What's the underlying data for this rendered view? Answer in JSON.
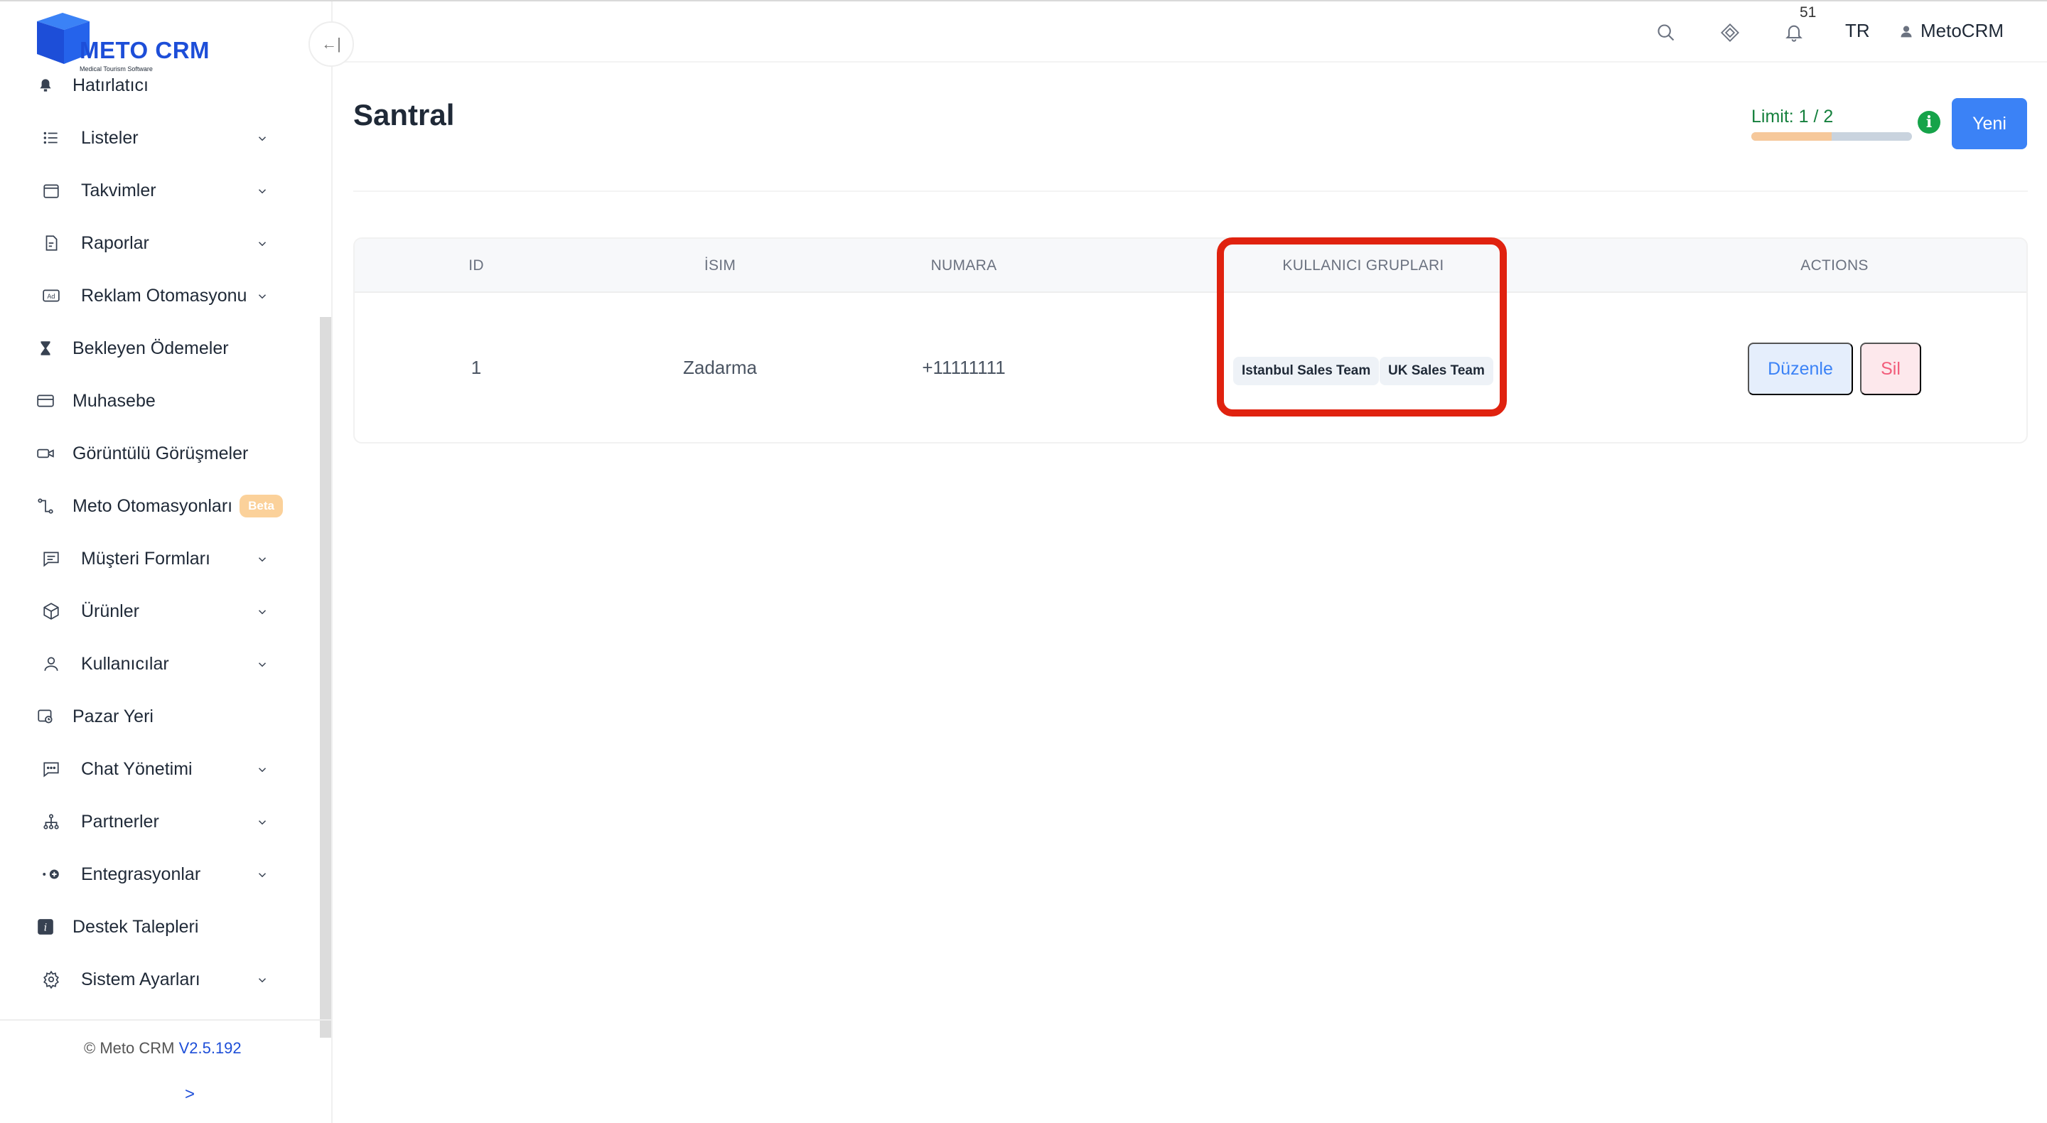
{
  "brand": {
    "name": "METO CRM",
    "tagline": "Medical Tourism Software"
  },
  "sidebar": {
    "items": [
      {
        "label": "Hatırlatıcı"
      },
      {
        "label": "Listeler"
      },
      {
        "label": "Takvimler"
      },
      {
        "label": "Raporlar"
      },
      {
        "label": "Reklam Otomasyonu"
      },
      {
        "label": "Bekleyen Ödemeler"
      },
      {
        "label": "Muhasebe"
      },
      {
        "label": "Görüntülü Görüşmeler"
      },
      {
        "label": "Meto Otomasyonları",
        "badge": "Beta"
      },
      {
        "label": "Müşteri Formları"
      },
      {
        "label": "Ürünler"
      },
      {
        "label": "Kullanıcılar"
      },
      {
        "label": "Pazar Yeri"
      },
      {
        "label": "Chat Yönetimi"
      },
      {
        "label": "Partnerler"
      },
      {
        "label": "Entegrasyonlar"
      },
      {
        "label": "Destek Talepleri"
      },
      {
        "label": "Sistem Ayarları"
      }
    ],
    "footer": {
      "copyright": "© Meto CRM",
      "version": "V2.5.192",
      "expand_label": ">"
    },
    "collapse_label": "←|"
  },
  "header": {
    "notification_count": "51",
    "language": "TR",
    "user_name": "MetoCRM"
  },
  "page": {
    "title": "Santral",
    "limit_label": "Limit: 1 / 2",
    "limit_fraction": 0.5,
    "info_label": "i",
    "new_button": "Yeni"
  },
  "table": {
    "columns": [
      "ID",
      "İsim",
      "Numara",
      "Kullanıcı Grupları",
      "Actions"
    ],
    "rows": [
      {
        "id": "1",
        "name": "Zadarma",
        "number": "+11111111",
        "groups": [
          "Istanbul Sales Team",
          "UK Sales Team"
        ],
        "edit_label": "Düzenle",
        "delete_label": "Sil"
      }
    ]
  },
  "colors": {
    "accent": "#3b82f6",
    "brand": "#1d4ed8",
    "highlight": "#e0220f",
    "limit_text": "#15803d"
  }
}
